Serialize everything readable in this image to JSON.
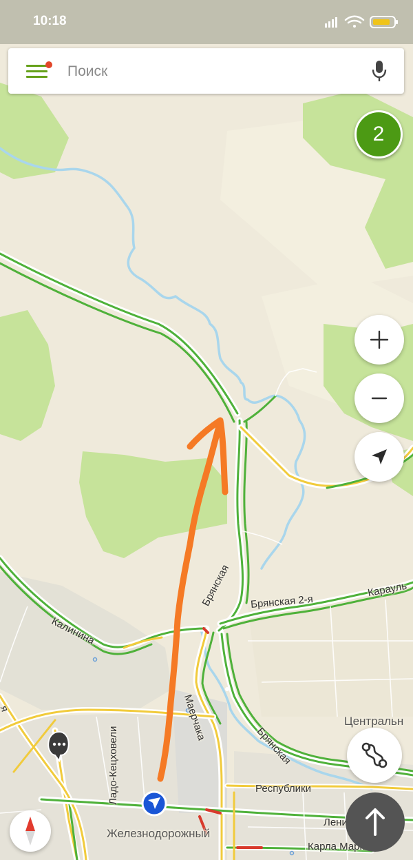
{
  "status_bar": {
    "time": "10:18",
    "icons": [
      "signal-icon",
      "wifi-icon",
      "battery-icon"
    ]
  },
  "search": {
    "placeholder": "Поиск",
    "has_notification_dot": true
  },
  "badge": {
    "count": "2"
  },
  "controls": {
    "zoom_in": "+",
    "zoom_out": "−",
    "icons": [
      "plus-icon",
      "minus-icon",
      "location-arrow-icon",
      "route-icon",
      "arrow-up-icon",
      "compass-icon",
      "chat-bubble-icon"
    ]
  },
  "map": {
    "street_labels": {
      "bryanskaya_1": "Брянская",
      "bryanskaya_2": "Брянская",
      "bryanskaya_2ya": "Брянская 2-я",
      "karaulnaya": "Карауль",
      "kalinina": "Калинина",
      "mayerchaka": "Маерчака",
      "lado": "Ладо-Кецховели",
      "respubliki": "Республики",
      "lenina": "Ленина",
      "karla_marksa": "Карла Маркса",
      "ya": "я"
    },
    "district_labels": {
      "centralny": "Центральн",
      "zheleznodorozhny": "Железнодорожный"
    },
    "colors": {
      "background": "#efeadb",
      "forest": "#c6e39a",
      "river": "#a9d6ec",
      "road_green": "#4fb13a",
      "road_yellow": "#f1cb3c",
      "road_red": "#d83a2c",
      "annotation_arrow": "#f57a25"
    }
  }
}
